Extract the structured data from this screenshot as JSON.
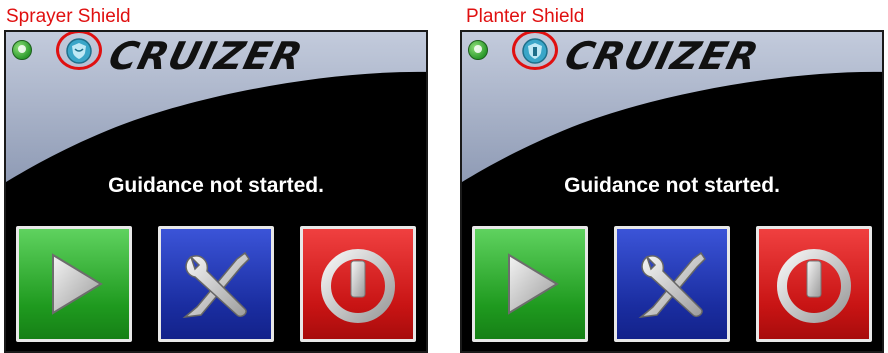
{
  "panels": [
    {
      "caption": "Sprayer Shield",
      "brand": "CRUIZER",
      "status_icon": "green-status-icon",
      "shield_icon": "sprayer-shield-icon",
      "message": "Guidance not started.",
      "buttons": [
        {
          "icon": "play-icon",
          "color": "#2fae2f"
        },
        {
          "icon": "wrench-screwdriver-icon",
          "color": "#1e35b8"
        },
        {
          "icon": "power-icon",
          "color": "#d41c1c"
        }
      ]
    },
    {
      "caption": "Planter Shield",
      "brand": "CRUIZER",
      "status_icon": "green-status-icon",
      "shield_icon": "planter-shield-icon",
      "message": "Guidance not started.",
      "buttons": [
        {
          "icon": "play-icon",
          "color": "#2fae2f"
        },
        {
          "icon": "wrench-screwdriver-icon",
          "color": "#1e35b8"
        },
        {
          "icon": "power-icon",
          "color": "#d41c1c"
        }
      ]
    }
  ],
  "colors": {
    "highlight": "#e01010",
    "screen_bg": "#000000",
    "header_bg": "#a9b3c9"
  }
}
